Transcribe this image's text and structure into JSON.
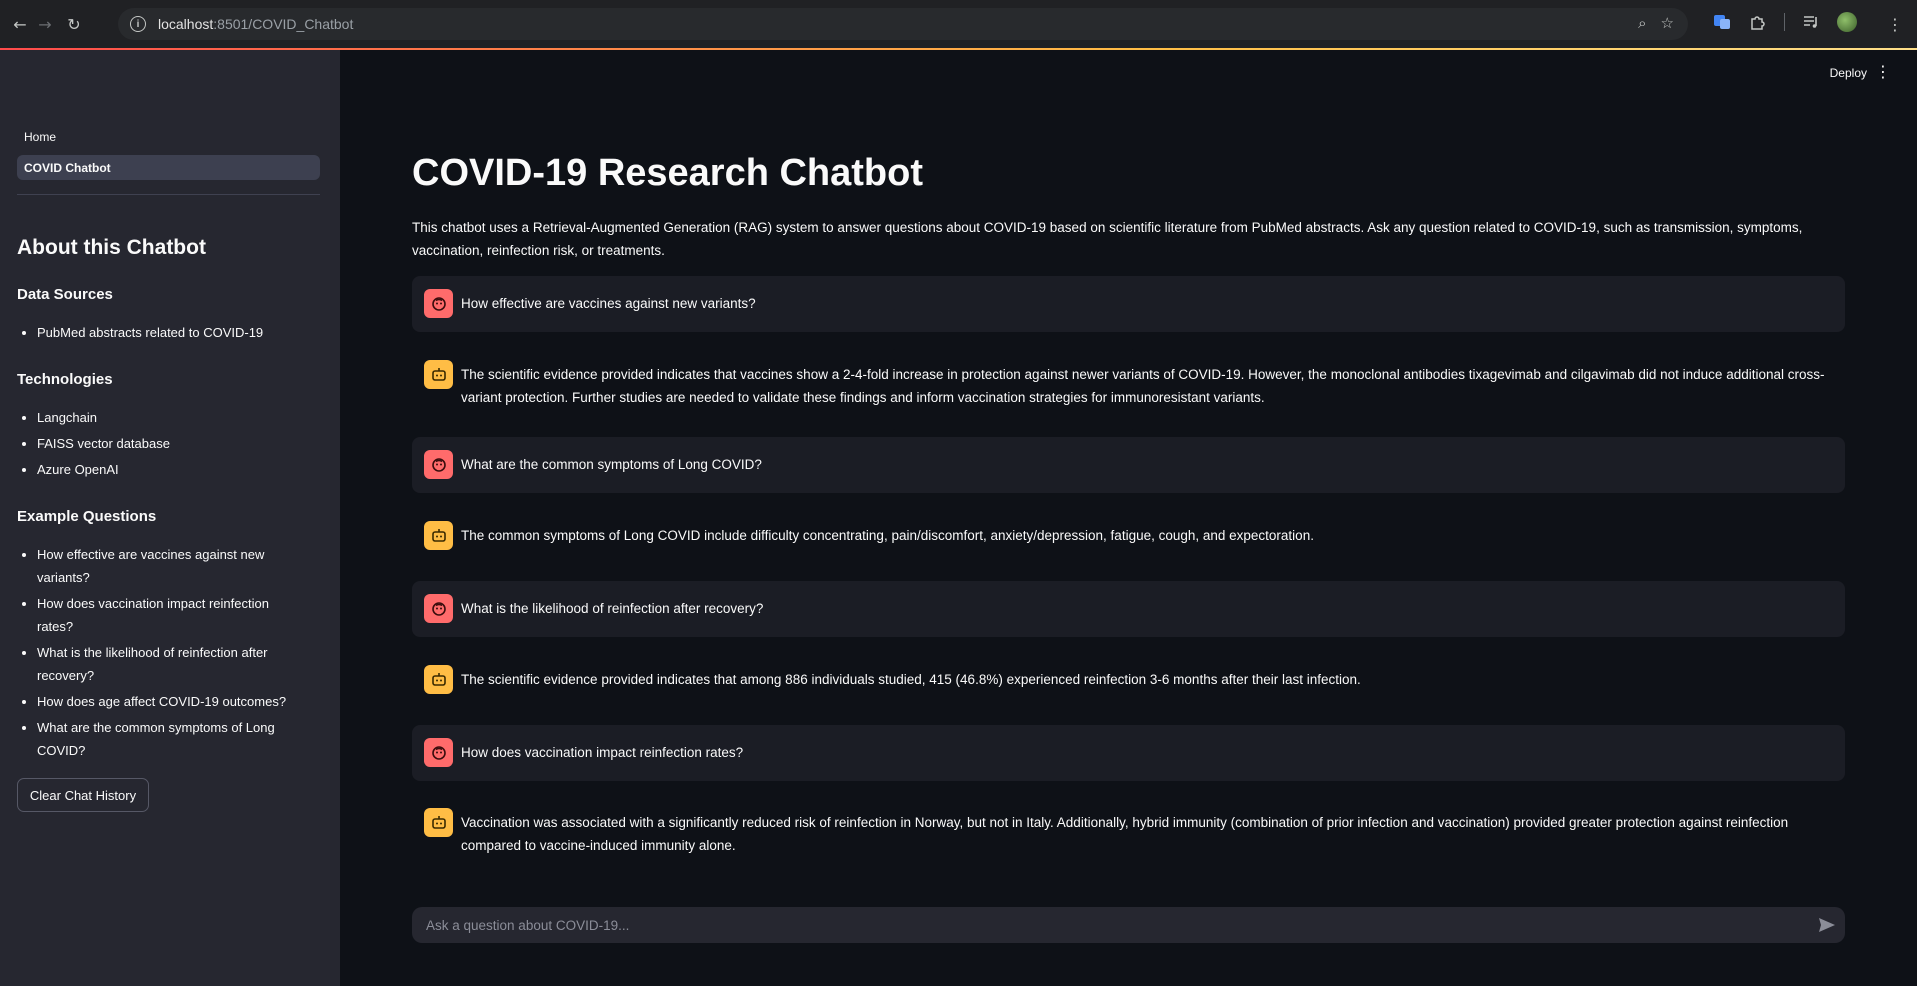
{
  "browser": {
    "url_host": "localhost",
    "url_rest": ":8501/COVID_Chatbot"
  },
  "sidebar": {
    "nav": [
      {
        "label": "Home"
      },
      {
        "label": "COVID Chatbot"
      }
    ],
    "about_title": "About this Chatbot",
    "data_sources_title": "Data Sources",
    "data_sources": [
      "PubMed abstracts related to COVID-19"
    ],
    "technologies_title": "Technologies",
    "technologies": [
      "Langchain",
      "FAISS vector database",
      "Azure OpenAI"
    ],
    "examples_title": "Example Questions",
    "examples": [
      "How effective are vaccines against new variants?",
      "How does vaccination impact reinfection rates?",
      "What is the likelihood of reinfection after recovery?",
      "How does age affect COVID-19 outcomes?",
      "What are the common symptoms of Long COVID?"
    ],
    "clear_button": "Clear Chat History"
  },
  "header": {
    "deploy_label": "Deploy"
  },
  "main": {
    "title": "COVID-19 Research Chatbot",
    "intro": "This chatbot uses a Retrieval-Augmented Generation (RAG) system to answer questions about COVID-19 based on scientific literature from PubMed abstracts. Ask any question related to COVID-19, such as transmission, symptoms, vaccination, reinfection risk, or treatments.",
    "messages": [
      {
        "role": "user",
        "text": "How effective are vaccines against new variants?"
      },
      {
        "role": "assistant",
        "text": "The scientific evidence provided indicates that vaccines show a 2-4-fold increase in protection against newer variants of COVID-19. However, the monoclonal antibodies tixagevimab and cilgavimab did not induce additional cross-variant protection. Further studies are needed to validate these findings and inform vaccination strategies for immunoresistant variants."
      },
      {
        "role": "user",
        "text": "What are the common symptoms of Long COVID?"
      },
      {
        "role": "assistant",
        "text": "The common symptoms of Long COVID include difficulty concentrating, pain/discomfort, anxiety/depression, fatigue, cough, and expectoration."
      },
      {
        "role": "user",
        "text": "What is the likelihood of reinfection after recovery?"
      },
      {
        "role": "assistant",
        "text": "The scientific evidence provided indicates that among 886 individuals studied, 415 (46.8%) experienced reinfection 3-6 months after their last infection."
      },
      {
        "role": "user",
        "text": "How does vaccination impact reinfection rates?"
      },
      {
        "role": "assistant",
        "text": "Vaccination was associated with a significantly reduced risk of reinfection in Norway, but not in Italy. Additionally, hybrid immunity (combination of prior infection and vaccination) provided greater protection against reinfection compared to vaccine-induced immunity alone."
      }
    ],
    "chat_placeholder": "Ask a question about COVID-19..."
  },
  "colors": {
    "user_avatar": "#ff6b6b",
    "assistant_avatar": "#ffbd45",
    "sidebar_bg": "#262730",
    "main_bg": "#0e1117"
  }
}
